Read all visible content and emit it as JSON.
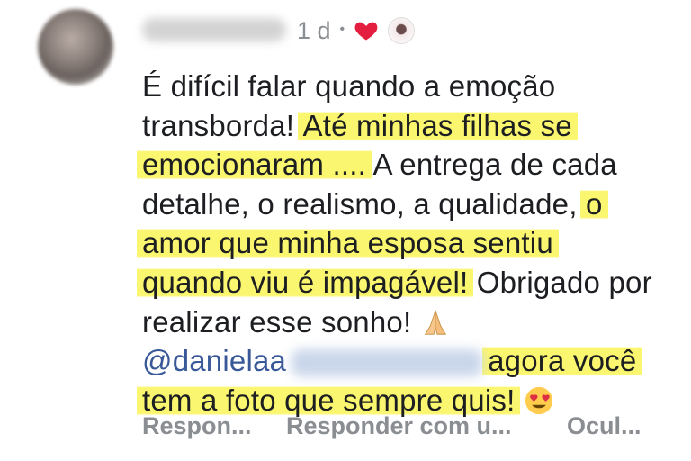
{
  "meta": {
    "time": "1 d",
    "separator": "•"
  },
  "comment": {
    "lines": [
      "É difícil falar quando a emoção",
      "transborda!",
      "Até minhas filhas se",
      "emocionaram ....",
      "A entrega de cada",
      "detalhe, o realismo, a qualidade,",
      "o",
      "amor que minha esposa sentiu",
      "quando viu é impagável!",
      "Obrigado por",
      "realizar esse sonho!",
      "@danielaa",
      "agora você",
      "tem a foto que sempre quis!"
    ]
  },
  "actions": {
    "reply": "Respon...",
    "reply_with": "Responder com u...",
    "hide": "Ocul..."
  },
  "colors": {
    "highlight": "#faf55f",
    "mention": "#385898",
    "muted": "#8a8d91",
    "heart": "#e41e3f"
  },
  "icons": [
    "heart-reaction-icon",
    "praying-hands-emoji",
    "heart-eyes-emoji"
  ]
}
